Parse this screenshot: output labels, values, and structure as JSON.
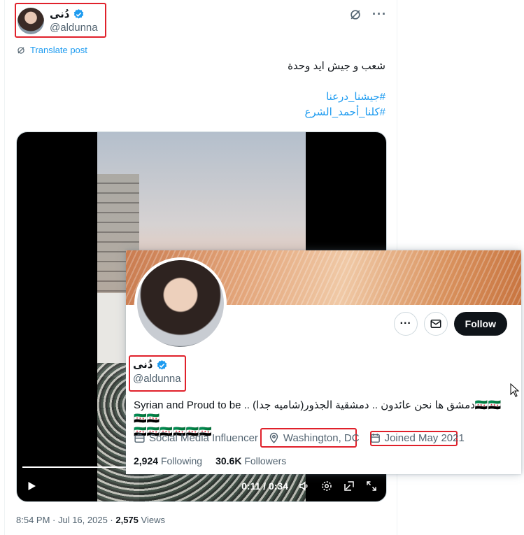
{
  "author": {
    "display_name": "دُنى",
    "handle": "@aldunna"
  },
  "translate_label": "Translate post",
  "tweet": {
    "line1": "شعب و جيش ايد وحدة",
    "hashtag1": "#جيشنا_درعنا",
    "hashtag2": "#كلنا_أحمد_الشرع"
  },
  "video": {
    "time": "0:11 / 0:34",
    "progress": 0.324
  },
  "meta": {
    "time": "8:54 PM · Jul 16, 2025 · ",
    "views_count": "2,575",
    "views_label": " Views"
  },
  "card": {
    "display_name": "دُنى",
    "handle": "@aldunna",
    "follow_label": "Follow",
    "bio_line1_en": "Syrian and Proud to be .. (",
    "bio_line1_ar": "دمشق ها نحن عائدون .. دمشقية الجذور(شاميه جدا",
    "bio_flags_inline": "🇸🇾🇸🇾🇸🇾🇸🇾",
    "bio_flags_line2": "🇸🇾🇸🇾🇸🇾🇸🇾🇸🇾🇸🇾",
    "category": "Social Media Influencer",
    "location": "Washington, DC",
    "joined": "Joined May 2021",
    "following_count": "2,924",
    "following_label": "Following",
    "followers_count": "30.6K",
    "followers_label": "Followers"
  },
  "colors": {
    "accent": "#1d9bf0",
    "annotation": "#e0212b",
    "text": "#0f1419",
    "muted": "#536471"
  }
}
